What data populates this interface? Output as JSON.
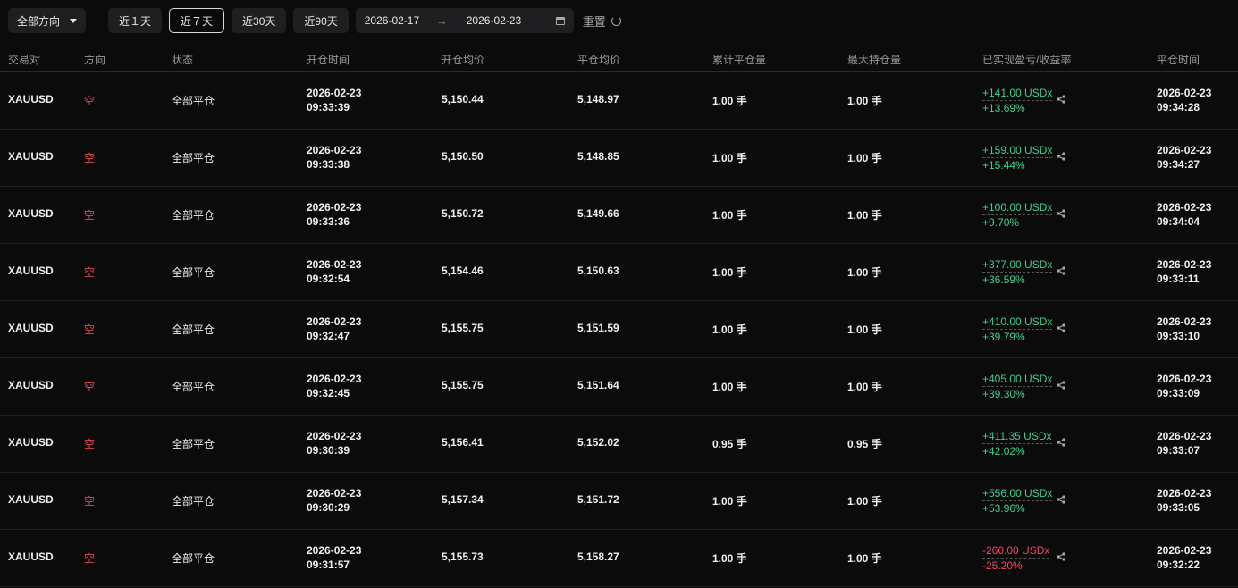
{
  "toolbar": {
    "direction": "全部方向",
    "ranges": [
      "近１天",
      "近７天",
      "近30天",
      "近90天"
    ],
    "active_range": 1,
    "date_from": "2026-02-17",
    "arrow": "→",
    "date_to": "2026-02-23",
    "reset": "重置"
  },
  "columns": [
    "交易对",
    "方向",
    "状态",
    "开仓时间",
    "开仓均价",
    "平仓均价",
    "累计平仓量",
    "最大持仓量",
    "已实现盈亏/收益率",
    "平仓时间"
  ],
  "colors": {
    "positive": "#3ecf8e",
    "negative": "#f6465d",
    "short": "#e5484d"
  },
  "rows": [
    {
      "pair": "XAUUSD",
      "side": "空",
      "status": "全部平仓",
      "open_date": "2026-02-23",
      "open_time": "09:33:39",
      "open_price": "5,150.44",
      "close_price": "5,148.97",
      "closed_qty": "1.00 手",
      "max_qty": "1.00 手",
      "pnl": "+141.00 USDx",
      "roi": "+13.69%",
      "positive": true,
      "close_date": "2026-02-23",
      "close_time": "09:34:28"
    },
    {
      "pair": "XAUUSD",
      "side": "空",
      "status": "全部平仓",
      "open_date": "2026-02-23",
      "open_time": "09:33:38",
      "open_price": "5,150.50",
      "close_price": "5,148.85",
      "closed_qty": "1.00 手",
      "max_qty": "1.00 手",
      "pnl": "+159.00 USDx",
      "roi": "+15.44%",
      "positive": true,
      "close_date": "2026-02-23",
      "close_time": "09:34:27"
    },
    {
      "pair": "XAUUSD",
      "side": "空",
      "status": "全部平仓",
      "open_date": "2026-02-23",
      "open_time": "09:33:36",
      "open_price": "5,150.72",
      "close_price": "5,149.66",
      "closed_qty": "1.00 手",
      "max_qty": "1.00 手",
      "pnl": "+100.00 USDx",
      "roi": "+9.70%",
      "positive": true,
      "close_date": "2026-02-23",
      "close_time": "09:34:04"
    },
    {
      "pair": "XAUUSD",
      "side": "空",
      "status": "全部平仓",
      "open_date": "2026-02-23",
      "open_time": "09:32:54",
      "open_price": "5,154.46",
      "close_price": "5,150.63",
      "closed_qty": "1.00 手",
      "max_qty": "1.00 手",
      "pnl": "+377.00 USDx",
      "roi": "+36.59%",
      "positive": true,
      "close_date": "2026-02-23",
      "close_time": "09:33:11"
    },
    {
      "pair": "XAUUSD",
      "side": "空",
      "status": "全部平仓",
      "open_date": "2026-02-23",
      "open_time": "09:32:47",
      "open_price": "5,155.75",
      "close_price": "5,151.59",
      "closed_qty": "1.00 手",
      "max_qty": "1.00 手",
      "pnl": "+410.00 USDx",
      "roi": "+39.79%",
      "positive": true,
      "close_date": "2026-02-23",
      "close_time": "09:33:10"
    },
    {
      "pair": "XAUUSD",
      "side": "空",
      "status": "全部平仓",
      "open_date": "2026-02-23",
      "open_time": "09:32:45",
      "open_price": "5,155.75",
      "close_price": "5,151.64",
      "closed_qty": "1.00 手",
      "max_qty": "1.00 手",
      "pnl": "+405.00 USDx",
      "roi": "+39.30%",
      "positive": true,
      "close_date": "2026-02-23",
      "close_time": "09:33:09"
    },
    {
      "pair": "XAUUSD",
      "side": "空",
      "status": "全部平仓",
      "open_date": "2026-02-23",
      "open_time": "09:30:39",
      "open_price": "5,156.41",
      "close_price": "5,152.02",
      "closed_qty": "0.95 手",
      "max_qty": "0.95 手",
      "pnl": "+411.35 USDx",
      "roi": "+42.02%",
      "positive": true,
      "close_date": "2026-02-23",
      "close_time": "09:33:07"
    },
    {
      "pair": "XAUUSD",
      "side": "空",
      "status": "全部平仓",
      "open_date": "2026-02-23",
      "open_time": "09:30:29",
      "open_price": "5,157.34",
      "close_price": "5,151.72",
      "closed_qty": "1.00 手",
      "max_qty": "1.00 手",
      "pnl": "+556.00 USDx",
      "roi": "+53.96%",
      "positive": true,
      "close_date": "2026-02-23",
      "close_time": "09:33:05"
    },
    {
      "pair": "XAUUSD",
      "side": "空",
      "status": "全部平仓",
      "open_date": "2026-02-23",
      "open_time": "09:31:57",
      "open_price": "5,155.73",
      "close_price": "5,158.27",
      "closed_qty": "1.00 手",
      "max_qty": "1.00 手",
      "pnl": "-260.00 USDx",
      "roi": "-25.20%",
      "positive": false,
      "close_date": "2026-02-23",
      "close_time": "09:32:22"
    }
  ]
}
